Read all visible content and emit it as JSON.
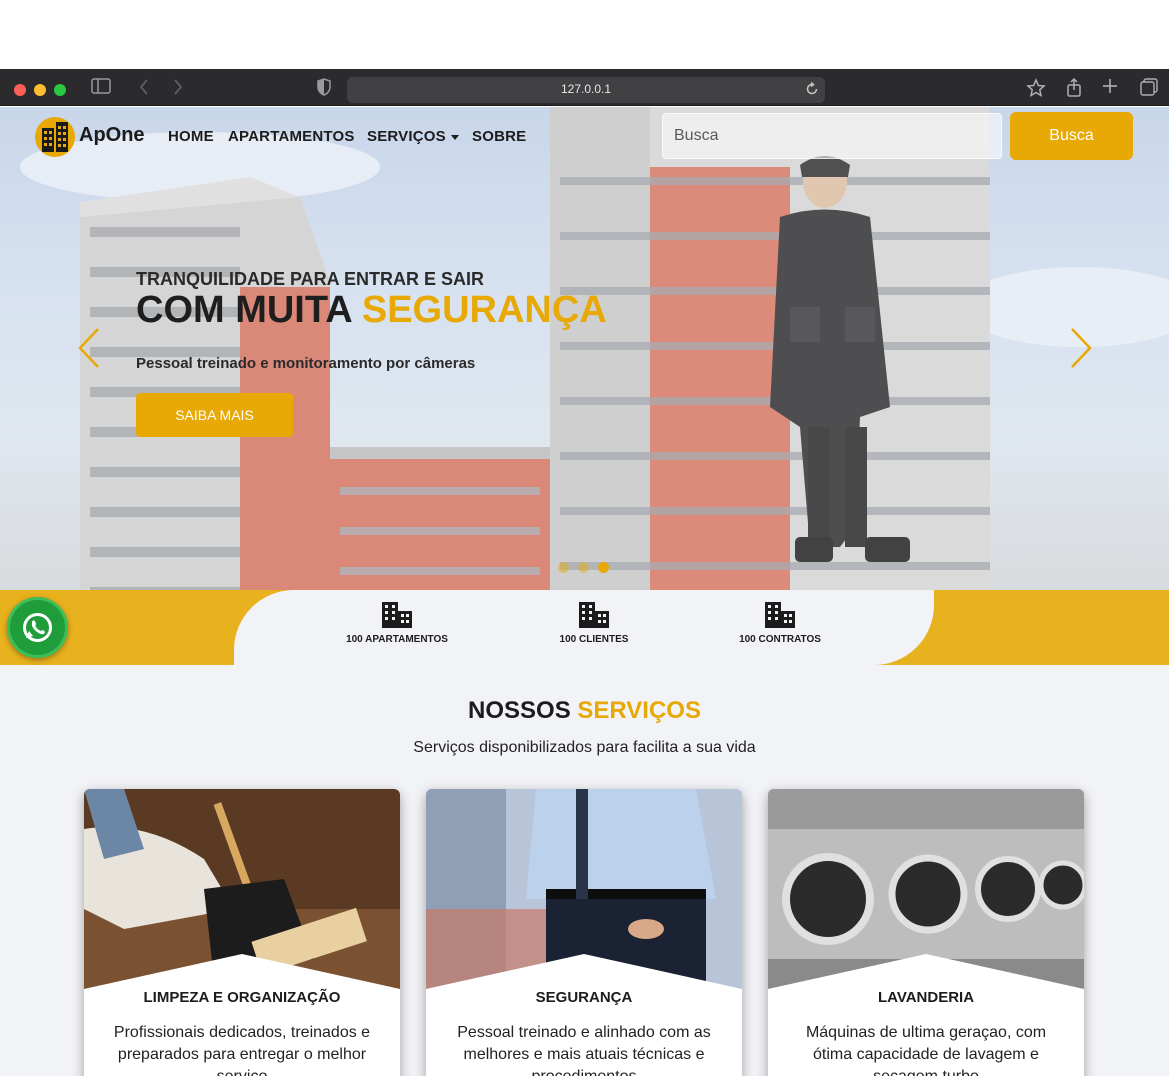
{
  "browser": {
    "url": "127.0.0.1"
  },
  "nav": {
    "brand": "ApOne",
    "links": [
      {
        "label": "HOME"
      },
      {
        "label": "APARTAMENTOS"
      },
      {
        "label": "SERVIÇOS"
      },
      {
        "label": "SOBRE"
      }
    ],
    "search_placeholder": "Busca",
    "search_button": "Busca"
  },
  "hero": {
    "kicker": "TRANQUILIDADE PARA ENTRAR E SAIR",
    "title_main": "COM MUITA ",
    "title_accent": "SEGURANÇA",
    "subtitle": "Pessoal treinado e monitoramento por câmeras",
    "cta": "SAIBA MAIS",
    "slide_count": 3,
    "active_slide": 3
  },
  "stats": [
    {
      "label": "100 APARTAMENTOS",
      "icon": "building-icon"
    },
    {
      "label": "100 CLIENTES",
      "icon": "building-icon"
    },
    {
      "label": "100 CONTRATOS",
      "icon": "building-icon"
    }
  ],
  "services": {
    "heading_main": "NOSSOS ",
    "heading_accent": "SERVIÇOS",
    "subtitle": "Serviços disponibilizados para facilita a sua vida",
    "cards": [
      {
        "title": "LIMPEZA E ORGANIZAÇÃO",
        "text": "Profissionais dedicados, treinados e preparados para entregar o melhor serviço"
      },
      {
        "title": "SEGURANÇA",
        "text": "Pessoal treinado e alinhado com as melhores e mais atuais técnicas e procedimentos"
      },
      {
        "title": "LAVANDERIA",
        "text": "Máquinas de ultima geraçao, com ótima capacidade de lavagem e secagem turbo"
      }
    ]
  },
  "colors": {
    "accent": "#e8a805",
    "stats_band": "#e8b21e",
    "page_bg": "#f2f3f7",
    "whatsapp": "#1f9d3a"
  }
}
